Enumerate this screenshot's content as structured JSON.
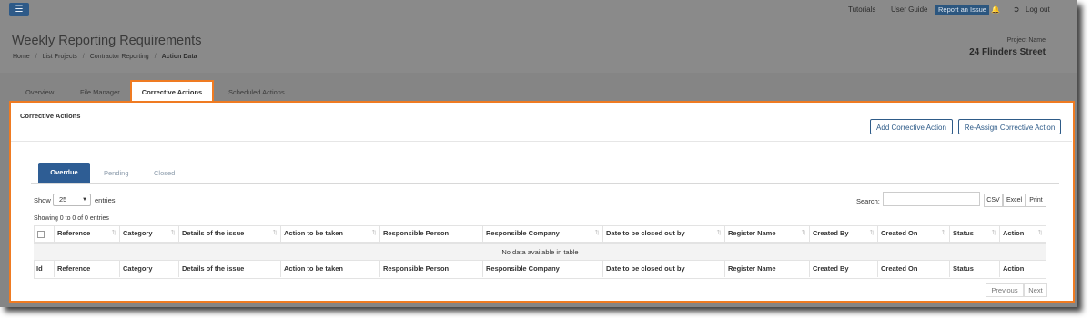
{
  "navbar": {
    "menu_icon": "hamburger-icon",
    "tutorials": "Tutorials",
    "user_guide": "User Guide",
    "report_issue": "Report an Issue",
    "bell_icon": "bell-icon",
    "logout_icon": "logout-icon",
    "logout": "Log out"
  },
  "header": {
    "title": "Weekly Reporting Requirements",
    "breadcrumb": [
      "Home",
      "List Projects",
      "Contractor Reporting",
      "Action Data"
    ],
    "project_label": "Project Name",
    "project_name": "24 Flinders Street"
  },
  "tabs": [
    "Overview",
    "File Manager",
    "Corrective Actions",
    "Scheduled Actions"
  ],
  "panel": {
    "title": "Corrective Actions",
    "add_button": "Add Corrective Action",
    "reassign_button": "Re-Assign Corrective Action",
    "inner_tabs": [
      "Overdue",
      "Pending",
      "Closed"
    ]
  },
  "table_controls": {
    "show": "Show",
    "entries_value": "25",
    "entries": "entries",
    "search_label": "Search:",
    "csv": "CSV",
    "excel": "Excel",
    "print": "Print",
    "showing": "Showing 0 to 0 of 0 entries"
  },
  "table": {
    "columns_top": [
      "",
      "Reference",
      "Category",
      "Details of the issue",
      "Action to be taken",
      "Responsible Person",
      "Responsible Company",
      "Date to be closed out by",
      "Register Name",
      "Created By",
      "Created On",
      "Status",
      "Action"
    ],
    "empty_message": "No data available in table",
    "columns_bottom": [
      "Id",
      "Reference",
      "Category",
      "Details of the issue",
      "Action to be taken",
      "Responsible Person",
      "Responsible Company",
      "Date to be closed out by",
      "Register Name",
      "Created By",
      "Created On",
      "Status",
      "Action"
    ]
  },
  "pagination": {
    "previous": "Previous",
    "next": "Next"
  },
  "colors": {
    "accent_orange": "#ef7b22",
    "primary_blue": "#2e5d94"
  }
}
